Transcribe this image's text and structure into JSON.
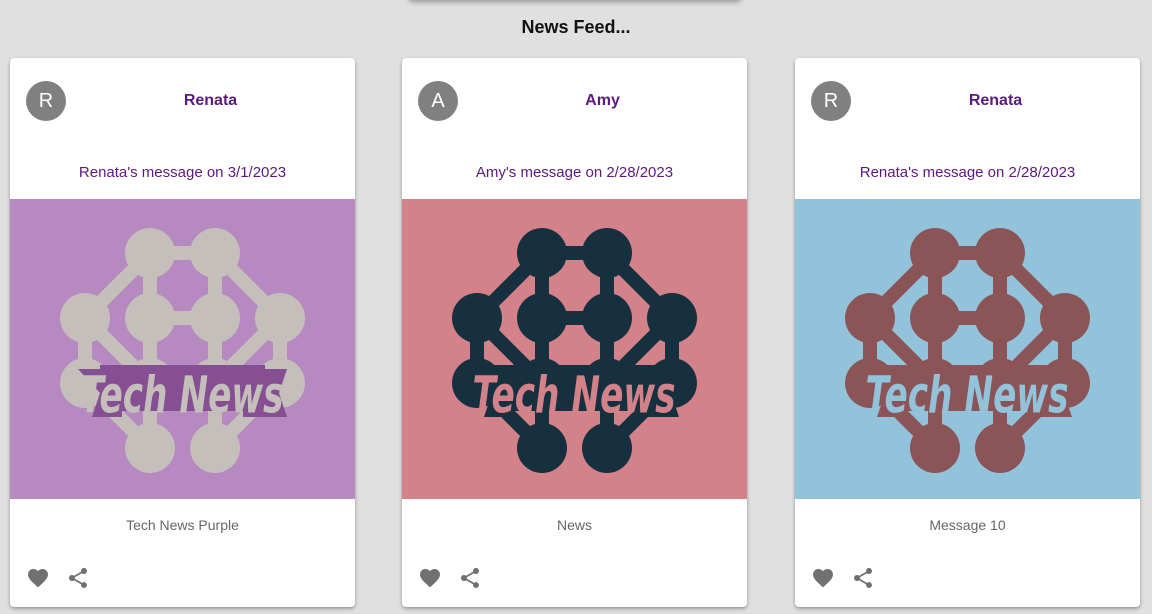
{
  "page": {
    "title": "News Feed..."
  },
  "cards": [
    {
      "avatar_letter": "R",
      "author": "Renata",
      "message": "Renata's message on 3/1/2023",
      "caption": "Tech News Purple",
      "image_text": "Tech News",
      "colors": {
        "background": "#b689c0",
        "shape": "#c5bfbb",
        "ribbon": "#874f93",
        "text": "#c5bfbb"
      }
    },
    {
      "avatar_letter": "A",
      "author": "Amy",
      "message": "Amy's message on 2/28/2023",
      "caption": "News",
      "image_text": "Tech News",
      "colors": {
        "background": "#d38289",
        "shape": "#16303f",
        "ribbon": "#16303f",
        "text": "#d38289"
      }
    },
    {
      "avatar_letter": "R",
      "author": "Renata",
      "message": "Renata's message on 2/28/2023",
      "caption": "Message 10",
      "image_text": "Tech News",
      "colors": {
        "background": "#92c3db",
        "shape": "#8b5557",
        "ribbon": "#8b5557",
        "text": "#92c3db"
      }
    }
  ],
  "icons": {
    "like": "heart-icon",
    "share": "share-icon"
  },
  "colors": {
    "page_background": "#e0e0e0",
    "accent": "#5c1a7a",
    "avatar": "#808080",
    "icon": "#707070"
  }
}
